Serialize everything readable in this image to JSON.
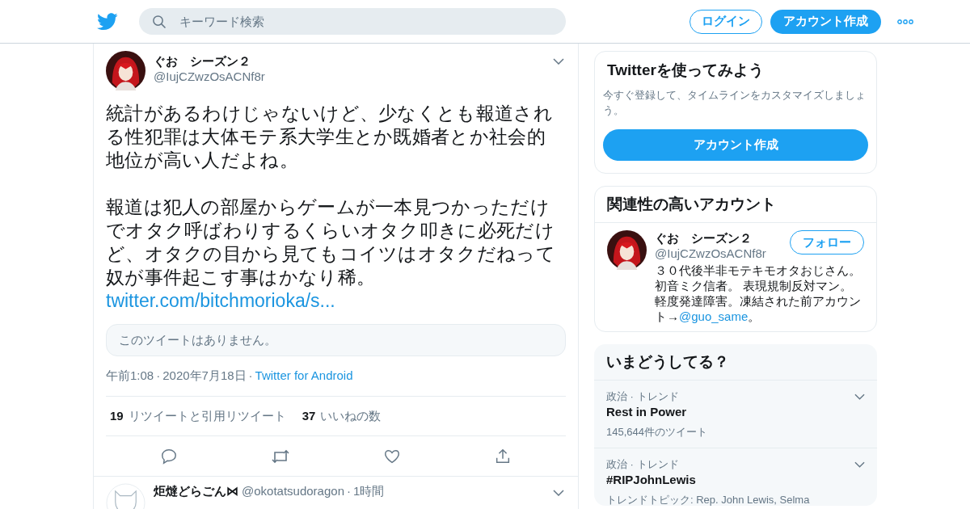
{
  "header": {
    "search": {
      "placeholder": "キーワード検索"
    },
    "login": "ログイン",
    "signup": "アカウント作成"
  },
  "tweet": {
    "name": "ぐお　シーズン２",
    "handle": "@IujCZwzOsACNf8r",
    "paragraphs": [
      "統計があるわけじゃないけど、少なくとも報道される性犯罪は大体モテ系大学生とか既婚者とか社会的地位が高い人だよね。",
      "報道は犯人の部屋からゲームが一本見つかっただけでオタク呼ばわりするくらいオタク叩きに必死だけど、オタクの目から見てもコイツはオタクだねって奴が事件起こす事はかなり稀。"
    ],
    "link": "twitter.com/bitchmorioka/s...",
    "quote_unavailable": "このツイートはありません。",
    "time": "午前1:08",
    "separator": "·",
    "date": "2020年7月18日",
    "separator_2": "·",
    "source": "Twitter for Android",
    "stats": [
      {
        "count": "19",
        "label": "リツイートと引用リツイート"
      },
      {
        "count": "37",
        "label": "いいねの数"
      }
    ]
  },
  "reply": {
    "name": "炬燵どらごん⋈",
    "handle": "@okotatsudoragon",
    "separator": "·",
    "time": "1時間"
  },
  "signup_card": {
    "title": "Twitterを使ってみよう",
    "text": "今すぐ登録して、タイムラインをカスタマイズしましょう。",
    "button": "アカウント作成"
  },
  "related": {
    "title": "関連性の高いアカウント",
    "account": {
      "name": "ぐお　シーズン２",
      "handle": "@IujCZwzOsACNf8r",
      "follow": "フォロー",
      "bio": "３０代後半非モテキモオタおじさん。初音ミク信者。 表現規制反対マン。軽度発達障害。凍結された前アカウント→",
      "bio_link": "@guo_same",
      "bio_end": "。"
    }
  },
  "trends": {
    "title": "いまどうしてる？",
    "items": [
      {
        "context": "政治 · トレンド",
        "name": "Rest in Power",
        "meta": "145,644件のツイート"
      },
      {
        "context": "政治 · トレンド",
        "name": "#RIPJohnLewis",
        "meta": "トレンドトピック: Rep. John Lewis, Selma"
      }
    ]
  }
}
